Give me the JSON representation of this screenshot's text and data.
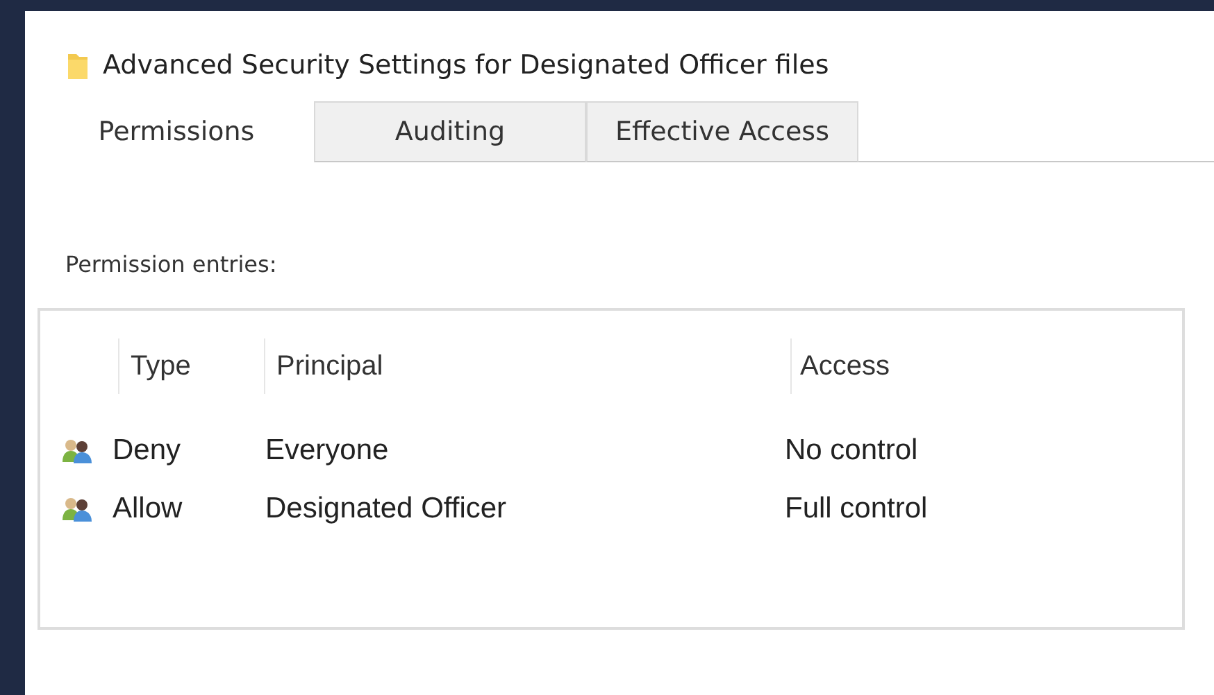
{
  "window": {
    "title": "Advanced Security Settings for Designated Officer files"
  },
  "tabs": [
    {
      "label": "Permissions",
      "selected": true
    },
    {
      "label": "Auditing",
      "selected": false
    },
    {
      "label": "Effective Access",
      "selected": false
    }
  ],
  "permission_entries": {
    "label": "Permission entries:",
    "columns": [
      "Type",
      "Principal",
      "Access"
    ],
    "rows": [
      {
        "type": "Deny",
        "principal": "Everyone",
        "access": "No control"
      },
      {
        "type": "Allow",
        "principal": "Designated Officer",
        "access": "Full control"
      }
    ]
  }
}
